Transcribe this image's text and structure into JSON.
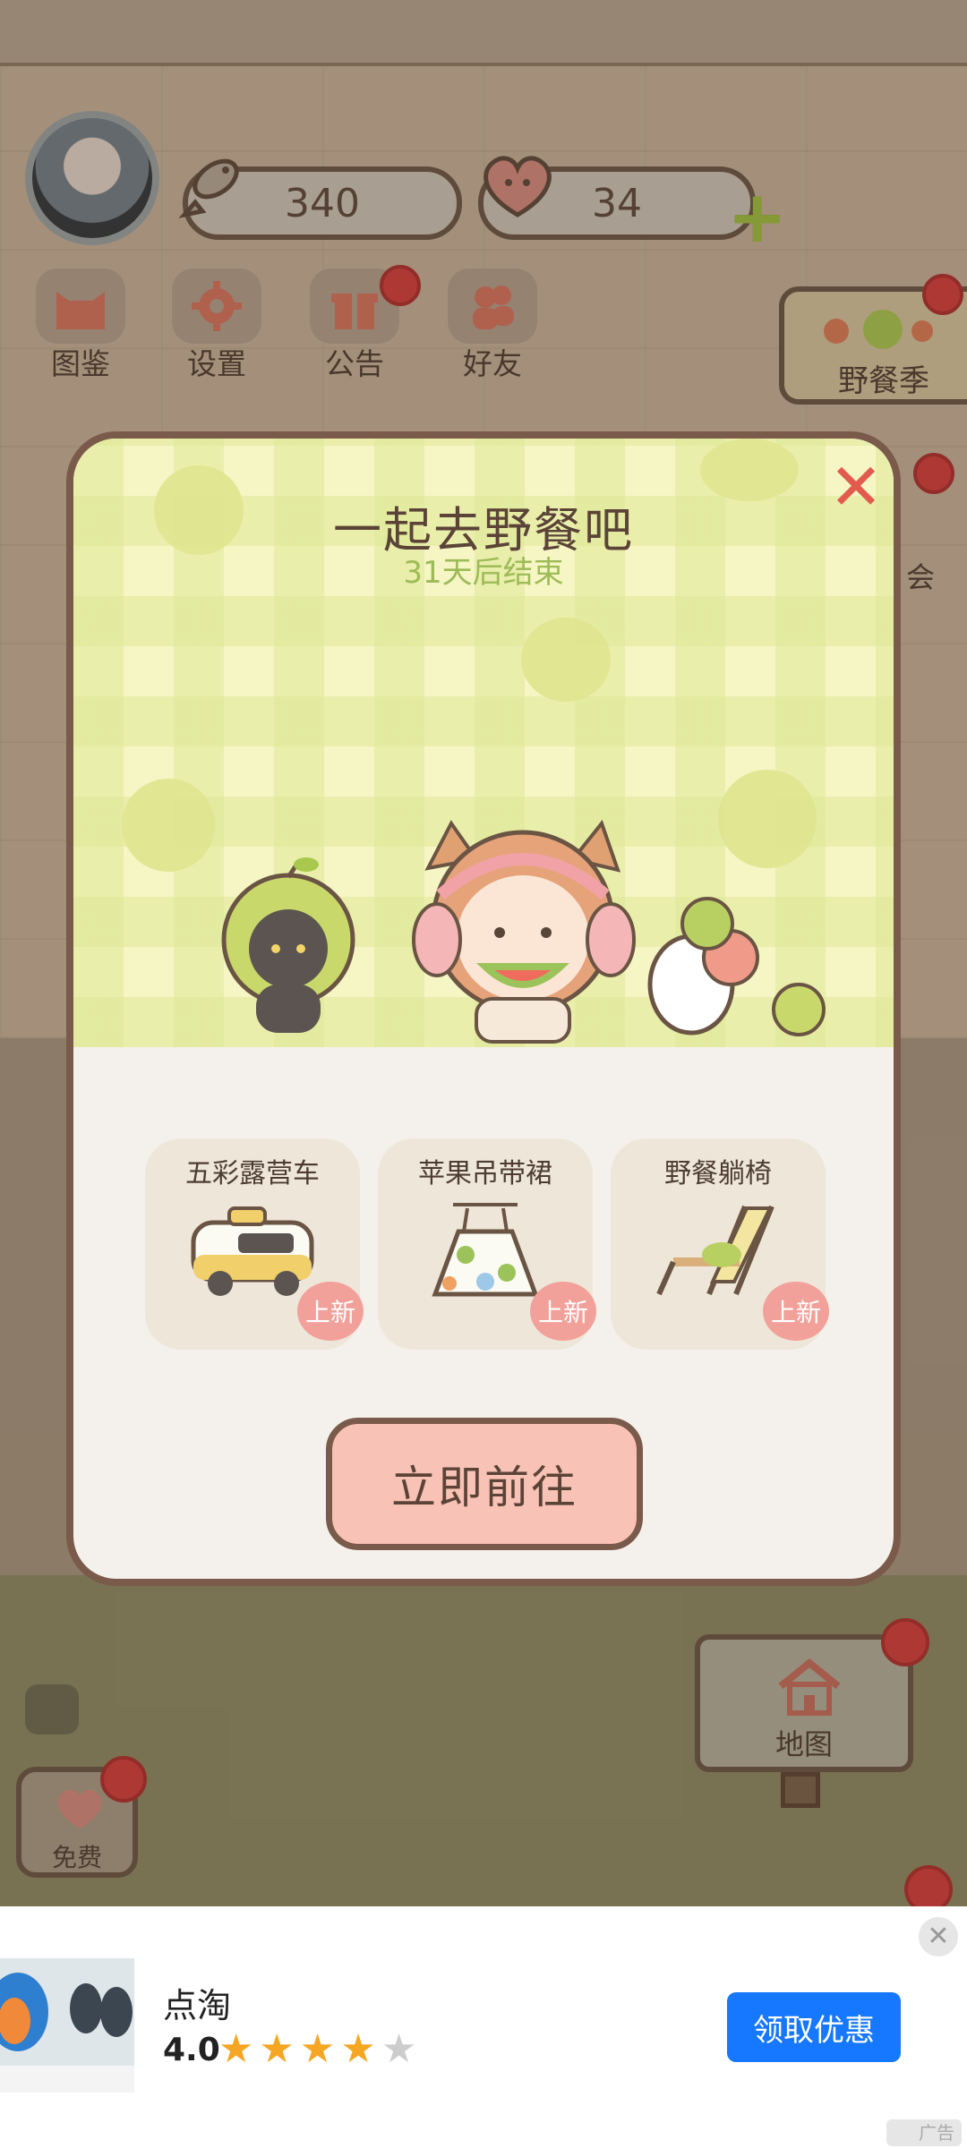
{
  "hud": {
    "fish_count": "340",
    "heart_count": "34"
  },
  "menu": {
    "items": [
      {
        "label": "图鉴",
        "icon": "cat-head-icon"
      },
      {
        "label": "设置",
        "icon": "gear-icon"
      },
      {
        "label": "公告",
        "icon": "gift-icon"
      },
      {
        "label": "好友",
        "icon": "friends-icon"
      }
    ]
  },
  "side": {
    "picnic_season_label": "野餐季",
    "partial_right_label": "会"
  },
  "modal": {
    "title": "一起去野餐吧",
    "subtitle": "31天后结束",
    "items": [
      {
        "name": "五彩露营车",
        "badge": "上新",
        "icon": "camper-van-icon"
      },
      {
        "name": "苹果吊带裙",
        "badge": "上新",
        "icon": "dress-icon"
      },
      {
        "name": "野餐躺椅",
        "badge": "上新",
        "icon": "deck-chair-icon"
      }
    ],
    "go_button": "立即前往"
  },
  "bottom": {
    "map_label": "地图",
    "free_label": "免费"
  },
  "ad": {
    "app_name": "点淘",
    "rating": "4.0",
    "stars_filled": 4,
    "stars_total": 5,
    "cta": "领取优惠",
    "tag": "广告",
    "cta_color": "#1677ff"
  }
}
